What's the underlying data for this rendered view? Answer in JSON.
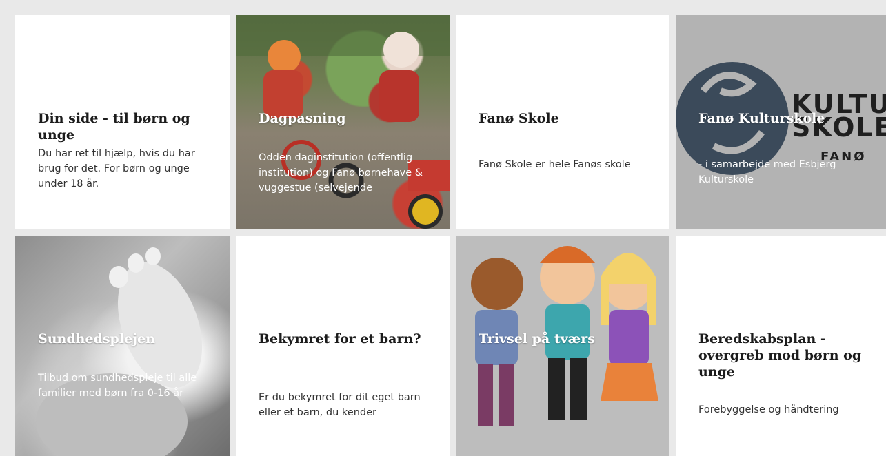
{
  "tiles": [
    {
      "title": "Din side - til børn og unge",
      "text": "Du har ret til hjælp, hvis du har brug for det. For børn og unge under 18 år."
    },
    {
      "title": "Dagpasning",
      "text": "Odden daginstitution (offentlig institution) og Fanø børnehave & vuggestue (selvejende"
    },
    {
      "title": "Fanø Skole",
      "text": "Fanø Skole er hele Fanøs skole"
    },
    {
      "title": "Fanø Kulturskole",
      "text": "- i samarbejde med Esbjerg Kulturskole"
    },
    {
      "title": "Sundhedsplejen",
      "text": "Tilbud om sundhedspleje til alle familier med børn fra 0-16 år"
    },
    {
      "title": "Bekymret for et barn?",
      "text": "Er du bekymret for dit eget barn eller et barn, du kender"
    },
    {
      "title": "Trivsel på tværs",
      "text": ""
    },
    {
      "title": "Beredskabsplan - overgreb mod børn og unge",
      "text": "Forebyggelse og håndtering"
    }
  ],
  "logo": {
    "line1": "KULTUR",
    "line2": "SKOLEN",
    "sub": "FANØ"
  }
}
